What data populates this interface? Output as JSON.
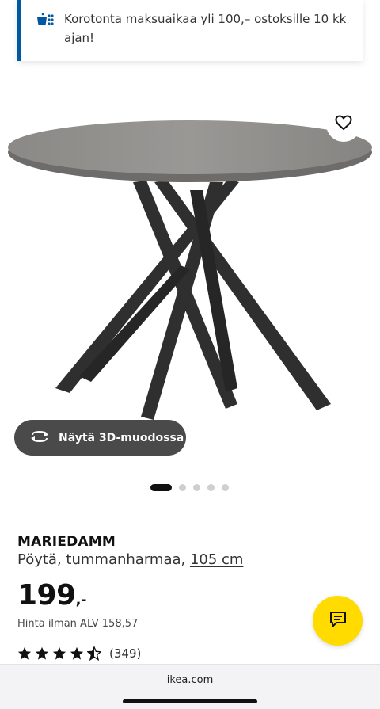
{
  "banner": {
    "text": "Korotonta maksuaikaa yli 100,– ostoksille 10 kk ajan!",
    "icon": "payment-calendar-icon",
    "accent": "#0058a3"
  },
  "gallery": {
    "view_3d_label": "Näytä 3D-muodossa",
    "image_count": 5,
    "active_index": 0,
    "favorite_icon": "heart-icon"
  },
  "product": {
    "name": "MARIEDAMM",
    "description": "Pöytä, tummanharmaa, ",
    "size": "105 cm",
    "price": "199",
    "price_suffix": ",-",
    "vat_text": "Hinta ilman ALV 158,57",
    "rating_value": 4.5,
    "rating_count": "(349)"
  },
  "chat": {
    "icon": "chat-icon",
    "color": "#ffdb00"
  },
  "browser": {
    "url": "ikea.com"
  }
}
